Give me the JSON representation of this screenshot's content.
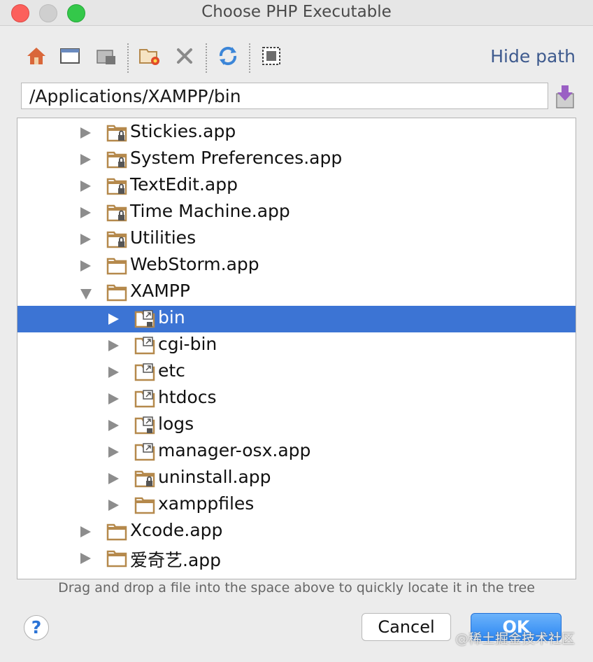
{
  "window": {
    "title": "Choose PHP Executable"
  },
  "toolbar": {
    "hide_path_label": "Hide path"
  },
  "path_field": {
    "value": "/Applications/XAMPP/bin"
  },
  "tree": {
    "rows": [
      {
        "label": "Stickies.app",
        "depth": 1,
        "state": "collapsed",
        "icon": "folder-locked-icon",
        "selected": false
      },
      {
        "label": "System Preferences.app",
        "depth": 1,
        "state": "collapsed",
        "icon": "folder-locked-icon",
        "selected": false
      },
      {
        "label": "TextEdit.app",
        "depth": 1,
        "state": "collapsed",
        "icon": "folder-locked-icon",
        "selected": false
      },
      {
        "label": "Time Machine.app",
        "depth": 1,
        "state": "collapsed",
        "icon": "folder-locked-icon",
        "selected": false
      },
      {
        "label": "Utilities",
        "depth": 1,
        "state": "collapsed",
        "icon": "folder-locked-icon",
        "selected": false
      },
      {
        "label": "WebStorm.app",
        "depth": 1,
        "state": "collapsed",
        "icon": "folder-icon",
        "selected": false
      },
      {
        "label": "XAMPP",
        "depth": 1,
        "state": "expanded",
        "icon": "folder-icon",
        "selected": false
      },
      {
        "label": "bin",
        "depth": 2,
        "state": "collapsed",
        "icon": "folder-alias-locked-icon",
        "selected": true
      },
      {
        "label": "cgi-bin",
        "depth": 2,
        "state": "collapsed",
        "icon": "folder-alias-icon",
        "selected": false
      },
      {
        "label": "etc",
        "depth": 2,
        "state": "collapsed",
        "icon": "folder-alias-icon",
        "selected": false
      },
      {
        "label": "htdocs",
        "depth": 2,
        "state": "collapsed",
        "icon": "folder-alias-icon",
        "selected": false
      },
      {
        "label": "logs",
        "depth": 2,
        "state": "collapsed",
        "icon": "folder-alias-locked-icon",
        "selected": false
      },
      {
        "label": "manager-osx.app",
        "depth": 2,
        "state": "collapsed",
        "icon": "folder-alias-icon",
        "selected": false
      },
      {
        "label": "uninstall.app",
        "depth": 2,
        "state": "collapsed",
        "icon": "folder-locked-icon",
        "selected": false
      },
      {
        "label": "xamppfiles",
        "depth": 2,
        "state": "collapsed",
        "icon": "folder-icon",
        "selected": false
      },
      {
        "label": "Xcode.app",
        "depth": 1,
        "state": "collapsed",
        "icon": "folder-icon",
        "selected": false
      },
      {
        "label": "爱奇艺.app",
        "depth": 1,
        "state": "collapsed",
        "icon": "folder-icon",
        "selected": false
      }
    ]
  },
  "hint": "Drag and drop a file into the space above to quickly locate it in the tree",
  "buttons": {
    "help": "?",
    "cancel": "Cancel",
    "ok": "OK"
  },
  "watermark": "@稀土掘金技术社区",
  "colors": {
    "selection": "#3c74d4",
    "folder": "#b5894c",
    "link": "#3e5a8e",
    "ok_button": "#2a86f3"
  }
}
